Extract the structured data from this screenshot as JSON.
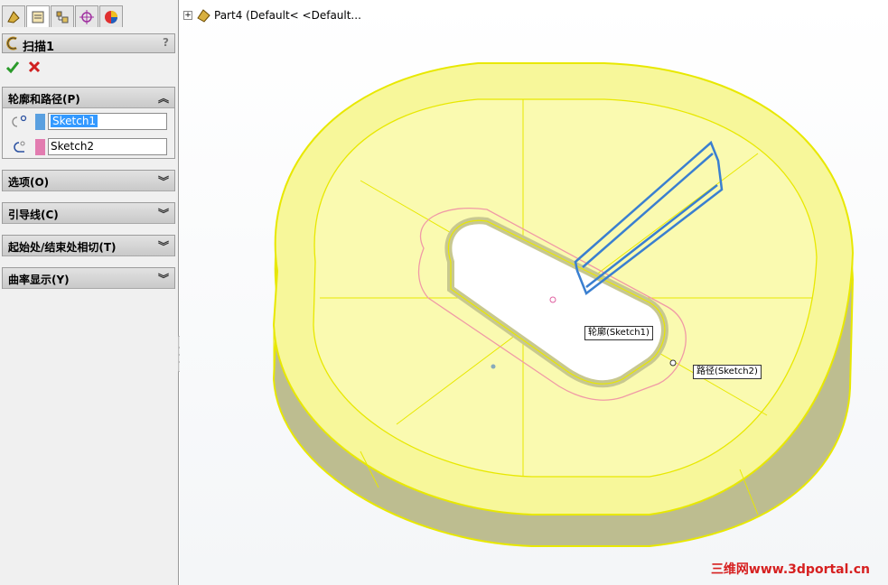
{
  "property_manager": {
    "feature_title": "扫描1",
    "help": "?",
    "groups": {
      "profile_path": "轮廓和路径(P)",
      "options": "选项(O)",
      "guide_curves": "引导线(C)",
      "start_end_tangency": "起始处/结束处相切(T)",
      "curvature_display": "曲率显示(Y)"
    },
    "profile_field": "Sketch1",
    "path_field": "Sketch2",
    "expanded_chevron": "︽",
    "collapsed_chevron": "︾",
    "colors": {
      "profile_swatch": "#5aa0e0",
      "path_swatch": "#e27cb0",
      "highlight": "#3399ff"
    }
  },
  "tree": {
    "expand": "+",
    "part_label": "Part4  (Default< <Default..."
  },
  "viewport": {
    "profile_callout": "轮廓(Sketch1)",
    "path_callout": "路径(Sketch2)",
    "watermark": "三维网www.3dportal.cn",
    "colors": {
      "preview_yellow": "#f7f79a",
      "edge_yellow": "#e8e800",
      "profile_blue": "#3a7fd0",
      "path_pink": "#f09aa6"
    }
  }
}
